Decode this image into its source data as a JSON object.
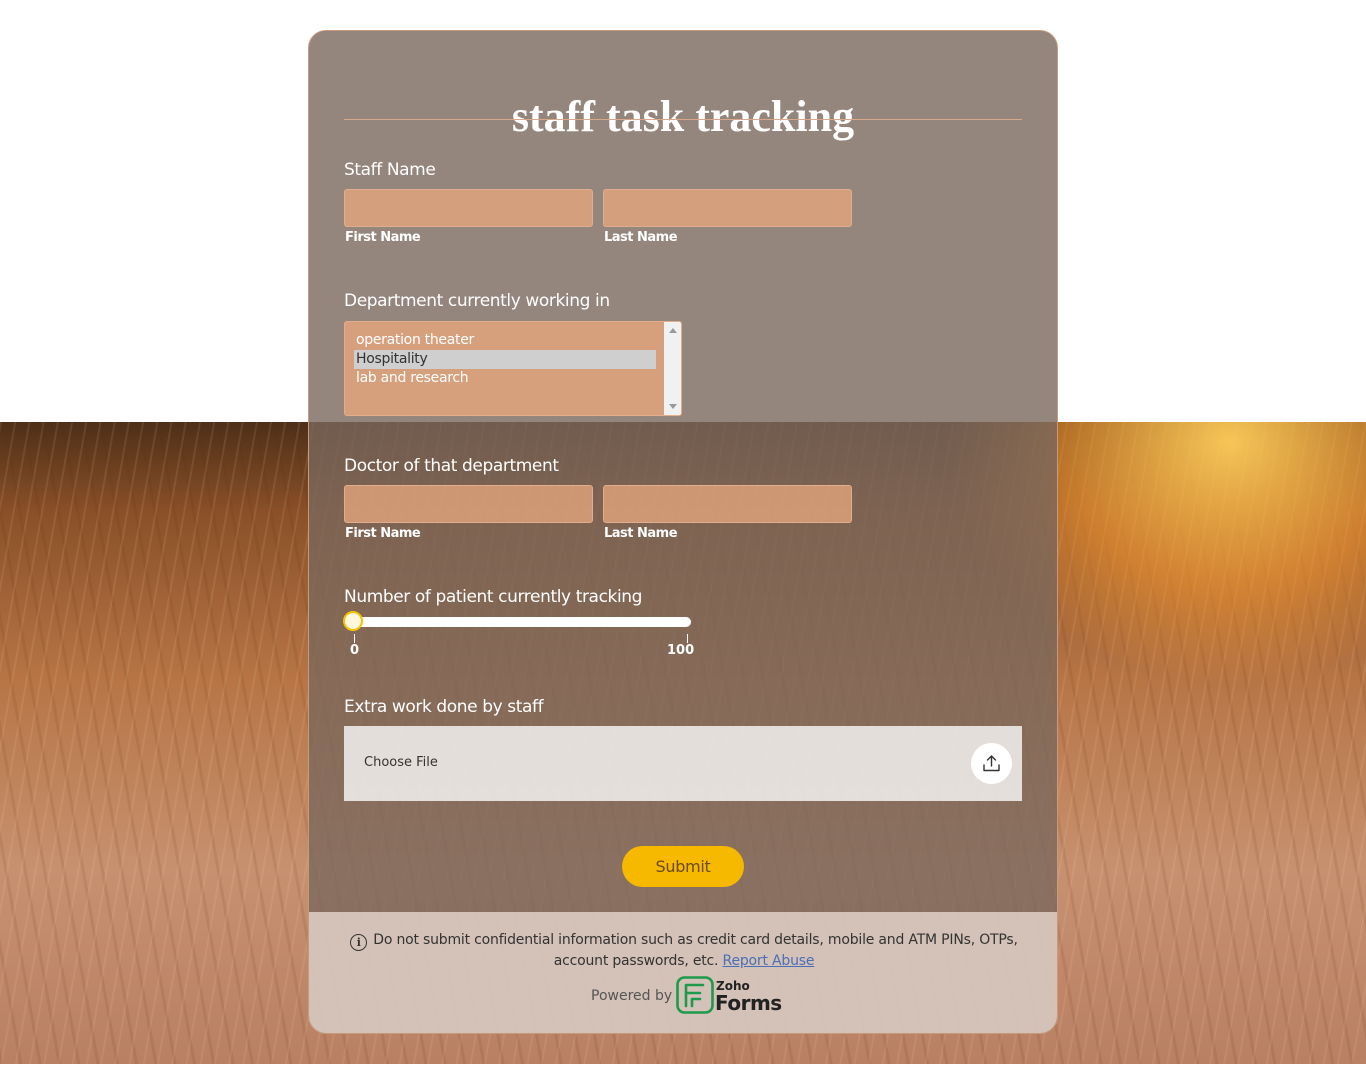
{
  "form": {
    "title": "staff task tracking",
    "staff_name": {
      "label": "Staff Name",
      "first_name": {
        "value": "",
        "sublabel": "First Name"
      },
      "last_name": {
        "value": "",
        "sublabel": "Last Name"
      }
    },
    "department": {
      "label": "Department currently working in",
      "options": [
        "operation theater",
        "Hospitality",
        "lab and research"
      ],
      "selected": "Hospitality"
    },
    "doctor": {
      "label": "Doctor of that department",
      "first_name": {
        "value": "",
        "sublabel": "First Name"
      },
      "last_name": {
        "value": "",
        "sublabel": "Last Name"
      }
    },
    "patients": {
      "label": "Number of patient currently tracking",
      "min": "0",
      "max": "100",
      "value": 0
    },
    "extra_work": {
      "label": "Extra work done by staff",
      "choose_file": "Choose File",
      "upload_icon": "upload-icon"
    },
    "submit_label": "Submit"
  },
  "footer": {
    "notice": "Do not submit confidential information such as credit card details, mobile and ATM PINs, OTPs, account passwords, etc.",
    "report_abuse": "Report Abuse",
    "powered_by": "Powered by",
    "brand_small": "Zoho",
    "brand_large": "Forms"
  },
  "colors": {
    "card_overlay": "#7a685c",
    "input_fill": "#e4a67e",
    "submit": "#f6b900",
    "slider_thumb_border": "#f6c200",
    "link": "#4a6fb5",
    "logo_green": "#1d9a4b"
  }
}
